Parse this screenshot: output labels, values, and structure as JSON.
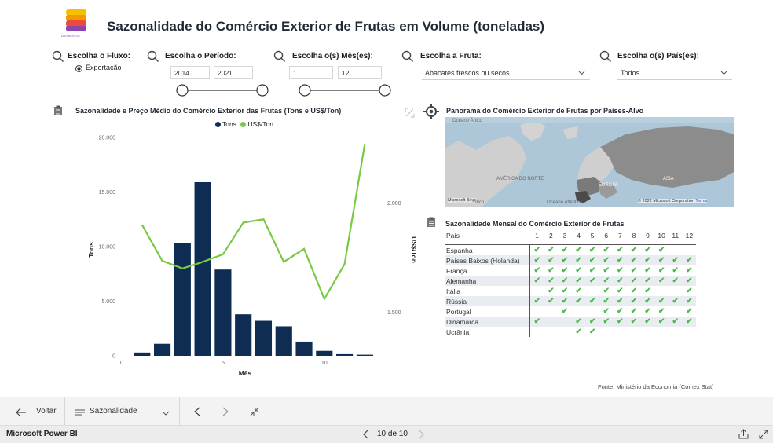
{
  "report": {
    "title": "Sazonalidade do Comércio Exterior de Frutas em Volume (toneladas)",
    "logo_text": "DATAMENTOS"
  },
  "filters": {
    "fluxo": {
      "label": "Escolha o Fluxo:",
      "option": "Exportação",
      "selected": true
    },
    "periodo": {
      "label": "Escolha o Período:",
      "from": "2014",
      "to": "2021",
      "slider_range": [
        0,
        1
      ]
    },
    "meses": {
      "label": "Escolha o(s) Mês(es):",
      "from": "1",
      "to": "12",
      "slider_range": [
        0,
        1
      ]
    },
    "fruta": {
      "label": "Escolha a Fruta:",
      "value": "Abacates frescos ou secos"
    },
    "paises": {
      "label": "Escolha o(s) País(es):",
      "value": "Todos"
    }
  },
  "combo_chart": {
    "title": "Sazonalidade e Preço Médio do Comércio Exterior das Frutas (Tons e US$/Ton)",
    "legend": [
      "Tons",
      "US$/Ton"
    ]
  },
  "chart_data": {
    "type": "bar",
    "title": "Sazonalidade e Preço Médio do Comércio Exterior das Frutas (Tons e US$/Ton)",
    "categories": [
      1,
      2,
      3,
      4,
      5,
      6,
      7,
      8,
      9,
      10,
      11,
      12
    ],
    "xlabel": "Mês",
    "x_ticks": [
      "0",
      "5",
      "10"
    ],
    "series": [
      {
        "name": "Tons",
        "type": "bar",
        "axis": "left",
        "color": "#0f2d52",
        "values": [
          300,
          1100,
          10300,
          15900,
          7900,
          3800,
          3200,
          2700,
          1300,
          450,
          150,
          100
        ]
      },
      {
        "name": "US$/Ton",
        "type": "line",
        "axis": "right",
        "color": "#7ac943",
        "values": [
          1900,
          1735,
          1700,
          1730,
          1765,
          1910,
          1925,
          1730,
          1790,
          1560,
          1720,
          2270
        ]
      }
    ],
    "ylabel": "Tons",
    "ylim": [
      0,
      20000
    ],
    "y_ticks": [
      "0",
      "5.000",
      "10.000",
      "15.000",
      "20.000"
    ],
    "y2label": "US$/Ton",
    "y2lim": [
      1300,
      2300
    ],
    "y2_ticks": [
      "1.500",
      "2.000"
    ],
    "legend_position": "top-center",
    "grid": false
  },
  "map": {
    "title": "Panorama do Comércio Exterior de Frutas por Países-Alvo",
    "labels": {
      "artico": "Oceano Ártico",
      "america": "AMÉRICA DO NORTE",
      "europa": "EUROPA",
      "asia": "ÁSIA",
      "pacifico": "Oceano Pacífico",
      "atlantico": "Oceano Atlântico"
    },
    "bing": "Microsoft Bing",
    "copyright": "© 2022 Microsoft Corporation",
    "terms": "Terms"
  },
  "season_table": {
    "title": "Sazonalidade Mensal do Comércio Exterior de Frutas",
    "header_country": "País",
    "months": [
      "1",
      "2",
      "3",
      "4",
      "5",
      "6",
      "7",
      "8",
      "9",
      "10",
      "11",
      "12"
    ],
    "check_symbol": "✔",
    "rows": [
      {
        "country": "Espanha",
        "checks": [
          1,
          1,
          1,
          1,
          1,
          1,
          1,
          1,
          1,
          1,
          0,
          0
        ]
      },
      {
        "country": "Países Baixos (Holanda)",
        "checks": [
          1,
          1,
          1,
          1,
          1,
          1,
          1,
          1,
          1,
          1,
          1,
          1
        ]
      },
      {
        "country": "França",
        "checks": [
          1,
          1,
          1,
          1,
          1,
          1,
          1,
          1,
          1,
          1,
          1,
          1
        ]
      },
      {
        "country": "Alemanha",
        "checks": [
          1,
          1,
          1,
          1,
          1,
          1,
          1,
          1,
          1,
          1,
          1,
          1
        ]
      },
      {
        "country": "Itália",
        "checks": [
          0,
          1,
          1,
          1,
          0,
          1,
          1,
          1,
          1,
          0,
          0,
          1
        ]
      },
      {
        "country": "Rússia",
        "checks": [
          1,
          1,
          1,
          1,
          1,
          1,
          1,
          1,
          1,
          1,
          1,
          1
        ]
      },
      {
        "country": "Portugal",
        "checks": [
          0,
          0,
          1,
          0,
          0,
          1,
          1,
          1,
          1,
          1,
          0,
          1
        ]
      },
      {
        "country": "Dinamarca",
        "checks": [
          1,
          0,
          0,
          1,
          1,
          1,
          1,
          1,
          1,
          1,
          1,
          1
        ]
      },
      {
        "country": "Ucrânia",
        "checks": [
          0,
          0,
          0,
          1,
          1,
          0,
          0,
          0,
          0,
          0,
          0,
          0
        ]
      }
    ]
  },
  "source": "Fonte: Ministério da Economia (Comex Stat)",
  "taskbar": {
    "back": "Voltar",
    "page_name": "Sazonalidade"
  },
  "statusbar": {
    "app": "Microsoft Power BI",
    "pager": "10 de 10"
  },
  "colors": {
    "bar": "#0f2d52",
    "line": "#7ac943",
    "check": "#4db74d"
  }
}
